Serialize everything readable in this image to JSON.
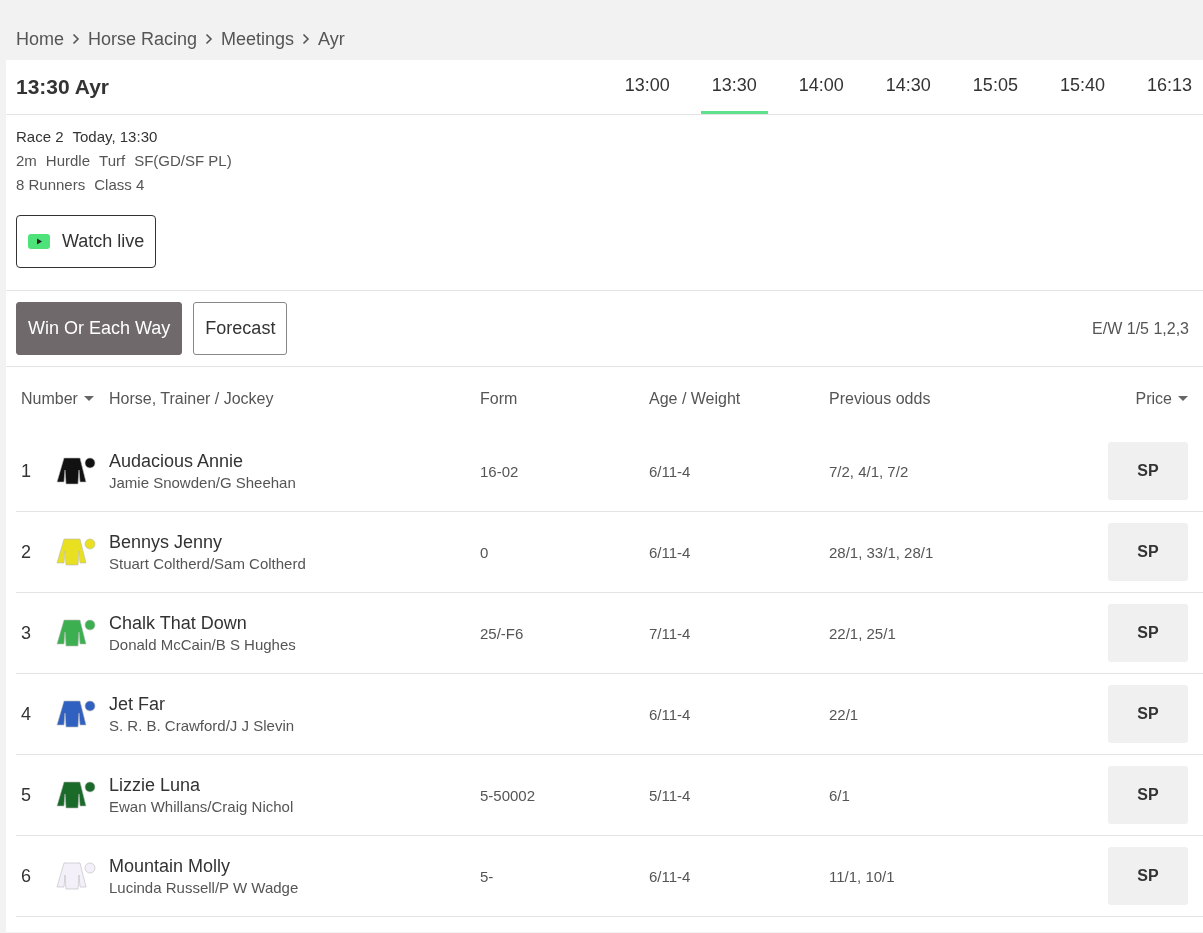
{
  "breadcrumb": [
    "Home",
    "Horse Racing",
    "Meetings",
    "Ayr"
  ],
  "race": {
    "title": "13:30 Ayr",
    "times": [
      {
        "label": "13:00",
        "selected": false
      },
      {
        "label": "13:30",
        "selected": true
      },
      {
        "label": "14:00",
        "selected": false
      },
      {
        "label": "14:30",
        "selected": false
      },
      {
        "label": "15:05",
        "selected": false
      },
      {
        "label": "15:40",
        "selected": false
      },
      {
        "label": "16:13",
        "selected": false
      }
    ],
    "info": [
      [
        "Race 2",
        "Today, 13:30"
      ],
      [
        "2m",
        "Hurdle",
        "Turf",
        "SF(GD/SF PL)"
      ],
      [
        "8 Runners",
        "Class 4"
      ]
    ],
    "watch_button": "Watch live"
  },
  "markets": [
    {
      "label": "Win Or Each Way",
      "selected": true
    },
    {
      "label": "Forecast",
      "selected": false
    }
  ],
  "each_way_terms": "E/W 1/5 1,2,3",
  "table": {
    "columns": [
      "Number",
      "Horse, Trainer / Jockey",
      "Form",
      "Age / Weight",
      "Previous odds",
      "Price"
    ],
    "rows": [
      {
        "number": "1",
        "horse": "Audacious Annie",
        "connections": "Jamie Snowden/G Sheehan",
        "form": "16-02",
        "age_weight": "6/11-4",
        "previous_odds": "7/2, 4/1, 7/2",
        "price": "SP",
        "color": "#111111"
      },
      {
        "number": "2",
        "horse": "Bennys Jenny",
        "connections": "Stuart Coltherd/Sam Coltherd",
        "form": "0",
        "age_weight": "6/11-4",
        "previous_odds": "28/1, 33/1, 28/1",
        "price": "SP",
        "color": "#e8e020"
      },
      {
        "number": "3",
        "horse": "Chalk That Down",
        "connections": "Donald McCain/B S Hughes",
        "form": "25/-F6",
        "age_weight": "7/11-4",
        "previous_odds": "22/1, 25/1",
        "price": "SP",
        "color": "#3cb050"
      },
      {
        "number": "4",
        "horse": "Jet Far",
        "connections": "S. R. B. Crawford/J J Slevin",
        "age_weight": "6/11-4",
        "previous_odds": "22/1",
        "price": "SP",
        "color": "#3060c0"
      },
      {
        "number": "5",
        "horse": "Lizzie Luna",
        "connections": "Ewan Whillans/Craig Nichol",
        "form": "5-50002",
        "age_weight": "5/11-4",
        "previous_odds": "6/1",
        "price": "SP",
        "color": "#1a6a2a"
      },
      {
        "number": "6",
        "horse": "Mountain Molly",
        "connections": "Lucinda Russell/P W Wadge",
        "form": "5-",
        "age_weight": "6/11-4",
        "previous_odds": "11/1, 10/1",
        "price": "SP",
        "color": "#f4f0fa"
      }
    ]
  }
}
